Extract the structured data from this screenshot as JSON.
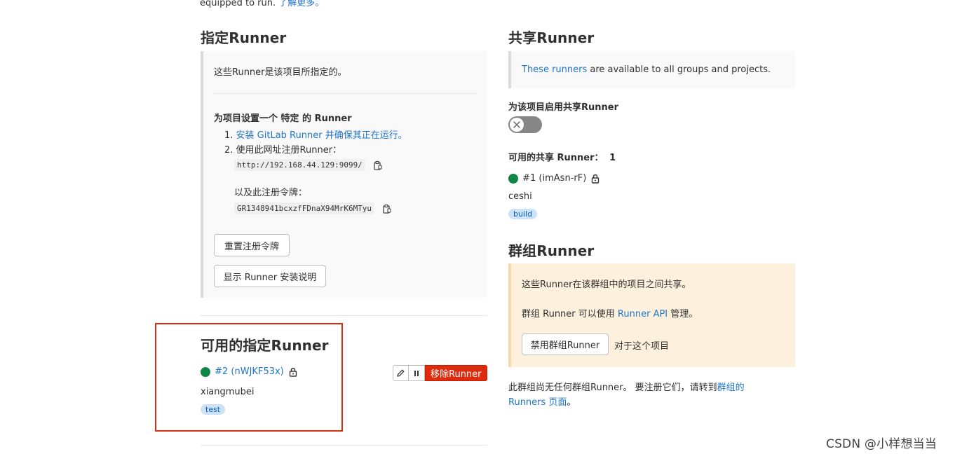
{
  "top_line": {
    "text": "equipped to run. ",
    "link": "了解更多。"
  },
  "specific": {
    "title": "指定Runner",
    "intro": "这些Runner是该项目所指定的。",
    "setup_title": "为项目设置一个 特定 的 Runner",
    "step1_num": "1.",
    "step1_link": "安装 GitLab Runner 并确保其正在运行。",
    "step2_num": "2.",
    "step2_text": "使用此网址注册Runner：",
    "url": "http://192.168.44.129:9099/",
    "token_label": "以及此注册令牌：",
    "token": "GR1348941bcxzfFDnaX94MrK6MTyu",
    "reset_button": "重置注册令牌",
    "show_button": "显示 Runner 安装说明"
  },
  "available_specific": {
    "title": "可用的指定Runner",
    "runner_link": "#2 (nWJKF53x)",
    "description": "xiangmubei",
    "tag": "test",
    "remove_button": "移除Runner",
    "status_color": "#108548"
  },
  "shared": {
    "title": "共享Runner",
    "info_link": "These runners",
    "info_text": " are available to all groups and projects.",
    "toggle_label": "为该项目启用共享Runner",
    "toggle_enabled": false,
    "available_label": "可用的共享 Runner：",
    "available_count": "1",
    "runner_name": "#1 (imAsn-rF)",
    "description": "ceshi",
    "tag": "build"
  },
  "group": {
    "title": "群组Runner",
    "line1": "这些Runner在该群组中的项目之间共享。",
    "line2_prefix": "群组 Runner 可以使用 ",
    "line2_link": "Runner API",
    "line2_suffix": " 管理。",
    "disable_button": "禁用群组Runner",
    "disable_suffix": "对于这个项目",
    "none_text": "此群组尚无任何群组Runner。 要注册它们，请转到",
    "none_link1": "群组的",
    "none_link2": "Runners 页面",
    "none_end": "。"
  },
  "watermark": "CSDN @小样想当当",
  "colors": {
    "link": "#1f75cb",
    "danger": "#dd2b0e",
    "success": "#108548",
    "tag_bg": "#cbe2f9",
    "warning_bg": "#fdf1dd"
  }
}
